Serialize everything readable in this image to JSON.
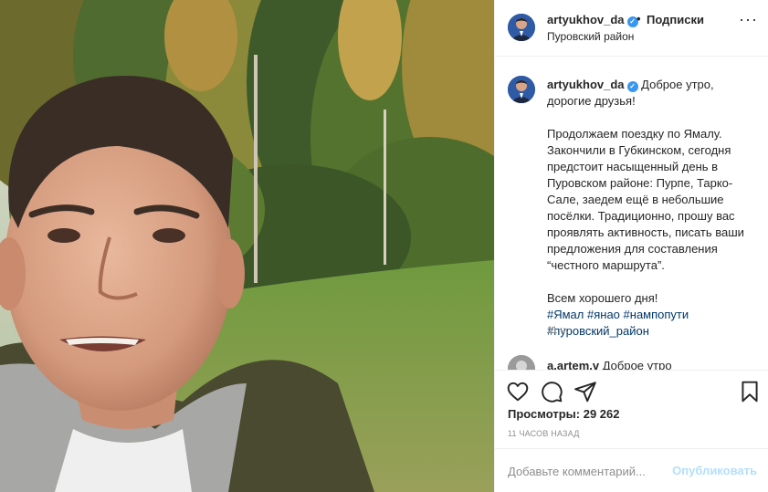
{
  "post": {
    "username": "artyukhov_da",
    "verified_icon": "verified-badge-icon",
    "dot": "•",
    "follow_label": "Подписки",
    "location": "Пуровский район",
    "more_icon": "more-options-icon"
  },
  "caption": {
    "username": "artyukhov_da",
    "first_line": "Доброе утро, дорогие друзья!",
    "body": "Продолжаем поездку по Ямалу. Закончили в Губкинском, сегодня предстоит насыщенный день в Пуровском районе: Пурпе, Тарко-Сале, заедем ещё в небольшие посёлки. Традиционно, прошу вас проявлять активность, писать ваши предложения для составления “честного маршрута”.",
    "closing": "Всем хорошего дня!",
    "hashtags": [
      "#Ямал",
      "#янао",
      "#нампопути",
      "#пуровский_район"
    ],
    "time": "11 ч."
  },
  "next_comment": {
    "username": "a.artem.v",
    "text": "Доброе утро"
  },
  "actions": {
    "like_icon": "heart-icon",
    "comment_icon": "comment-icon",
    "share_icon": "share-icon",
    "save_icon": "bookmark-icon"
  },
  "stats": {
    "views_label": "Просмотры:",
    "views_value": "29 262",
    "ago": "11 часов назад"
  },
  "comment_box": {
    "placeholder": "Добавьте комментарий...",
    "post_label": "Опубликовать"
  },
  "colors": {
    "link": "#00376b",
    "verified": "#3897f0",
    "post_button_disabled": "#b2dffc",
    "muted": "#8e8e8e"
  }
}
